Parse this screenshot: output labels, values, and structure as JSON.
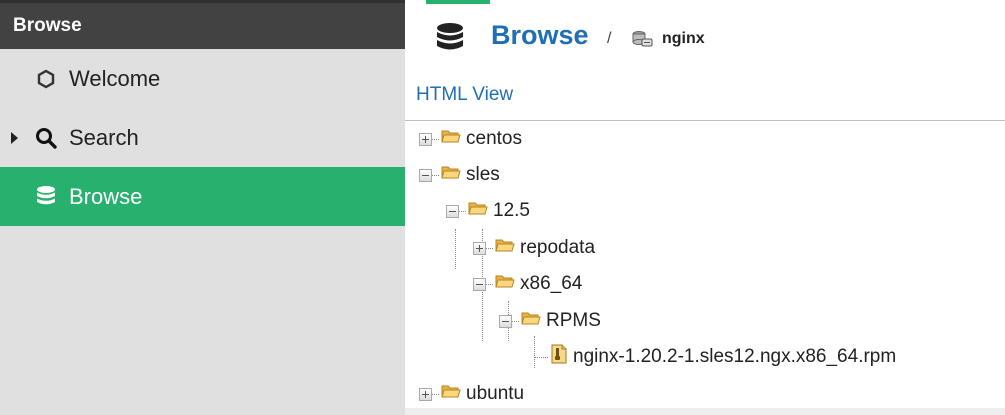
{
  "sidebar": {
    "title": "Browse",
    "items": [
      {
        "label": "Welcome",
        "icon": "hexagon-icon"
      },
      {
        "label": "Search",
        "icon": "search-icon"
      },
      {
        "label": "Browse",
        "icon": "database-icon",
        "active": true
      }
    ]
  },
  "breadcrumb": {
    "title": "Browse",
    "separator": "/",
    "repo": "nginx",
    "repo_icon": "repository-icon"
  },
  "main": {
    "html_view": "HTML View"
  },
  "tree": {
    "nodes": [
      {
        "label": "centos",
        "state": "collapsed",
        "type": "folder"
      },
      {
        "label": "sles",
        "state": "expanded",
        "type": "folder"
      },
      {
        "label": "12.5",
        "state": "expanded",
        "type": "folder"
      },
      {
        "label": "repodata",
        "state": "collapsed",
        "type": "folder"
      },
      {
        "label": "x86_64",
        "state": "expanded",
        "type": "folder"
      },
      {
        "label": "RPMS",
        "state": "expanded",
        "type": "folder"
      },
      {
        "label": "nginx-1.20.2-1.sles12.ngx.x86_64.rpm",
        "type": "file"
      },
      {
        "label": "ubuntu",
        "state": "collapsed",
        "type": "folder"
      }
    ]
  },
  "colors": {
    "accent_green": "#27b06e",
    "link_blue": "#1e6fb5",
    "sidebar_header": "#424242",
    "sidebar_bg": "#e0e0e0",
    "folder_yellow": "#f3c25a"
  }
}
